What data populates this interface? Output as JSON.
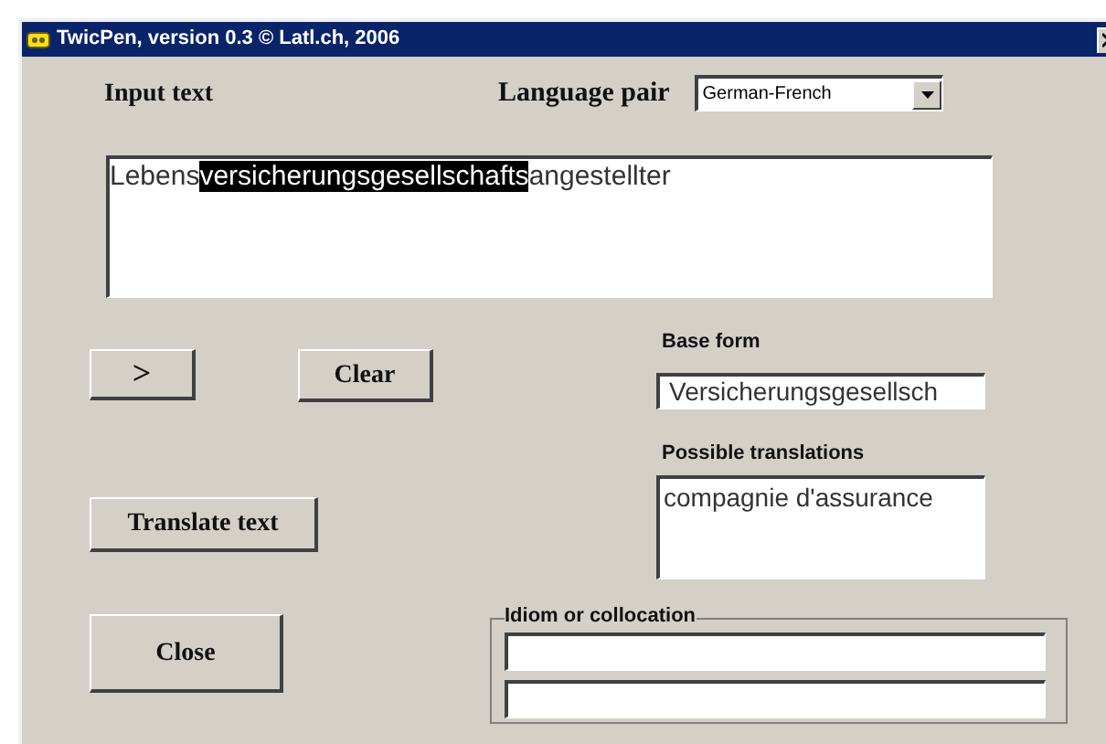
{
  "window": {
    "title": "TwicPen, version 0.3 © Latl.ch, 2006"
  },
  "input_text": {
    "label": "Input text",
    "segments": [
      {
        "text": "Lebens",
        "selected": false
      },
      {
        "text": "versicherungsgesellschafts",
        "selected": true
      },
      {
        "text": "angestellter",
        "selected": false
      }
    ]
  },
  "language_pair": {
    "label": "Language pair",
    "value": "German-French"
  },
  "buttons": {
    "next": ">",
    "clear": "Clear",
    "translate": "Translate text",
    "close": "Close"
  },
  "base_form": {
    "label": "Base form",
    "value": "Versicherungsgesellsch"
  },
  "possible_translations": {
    "label": "Possible translations",
    "value": "compagnie d'assurance"
  },
  "idiom_or_collocation": {
    "label": "Idiom or collocation"
  }
}
